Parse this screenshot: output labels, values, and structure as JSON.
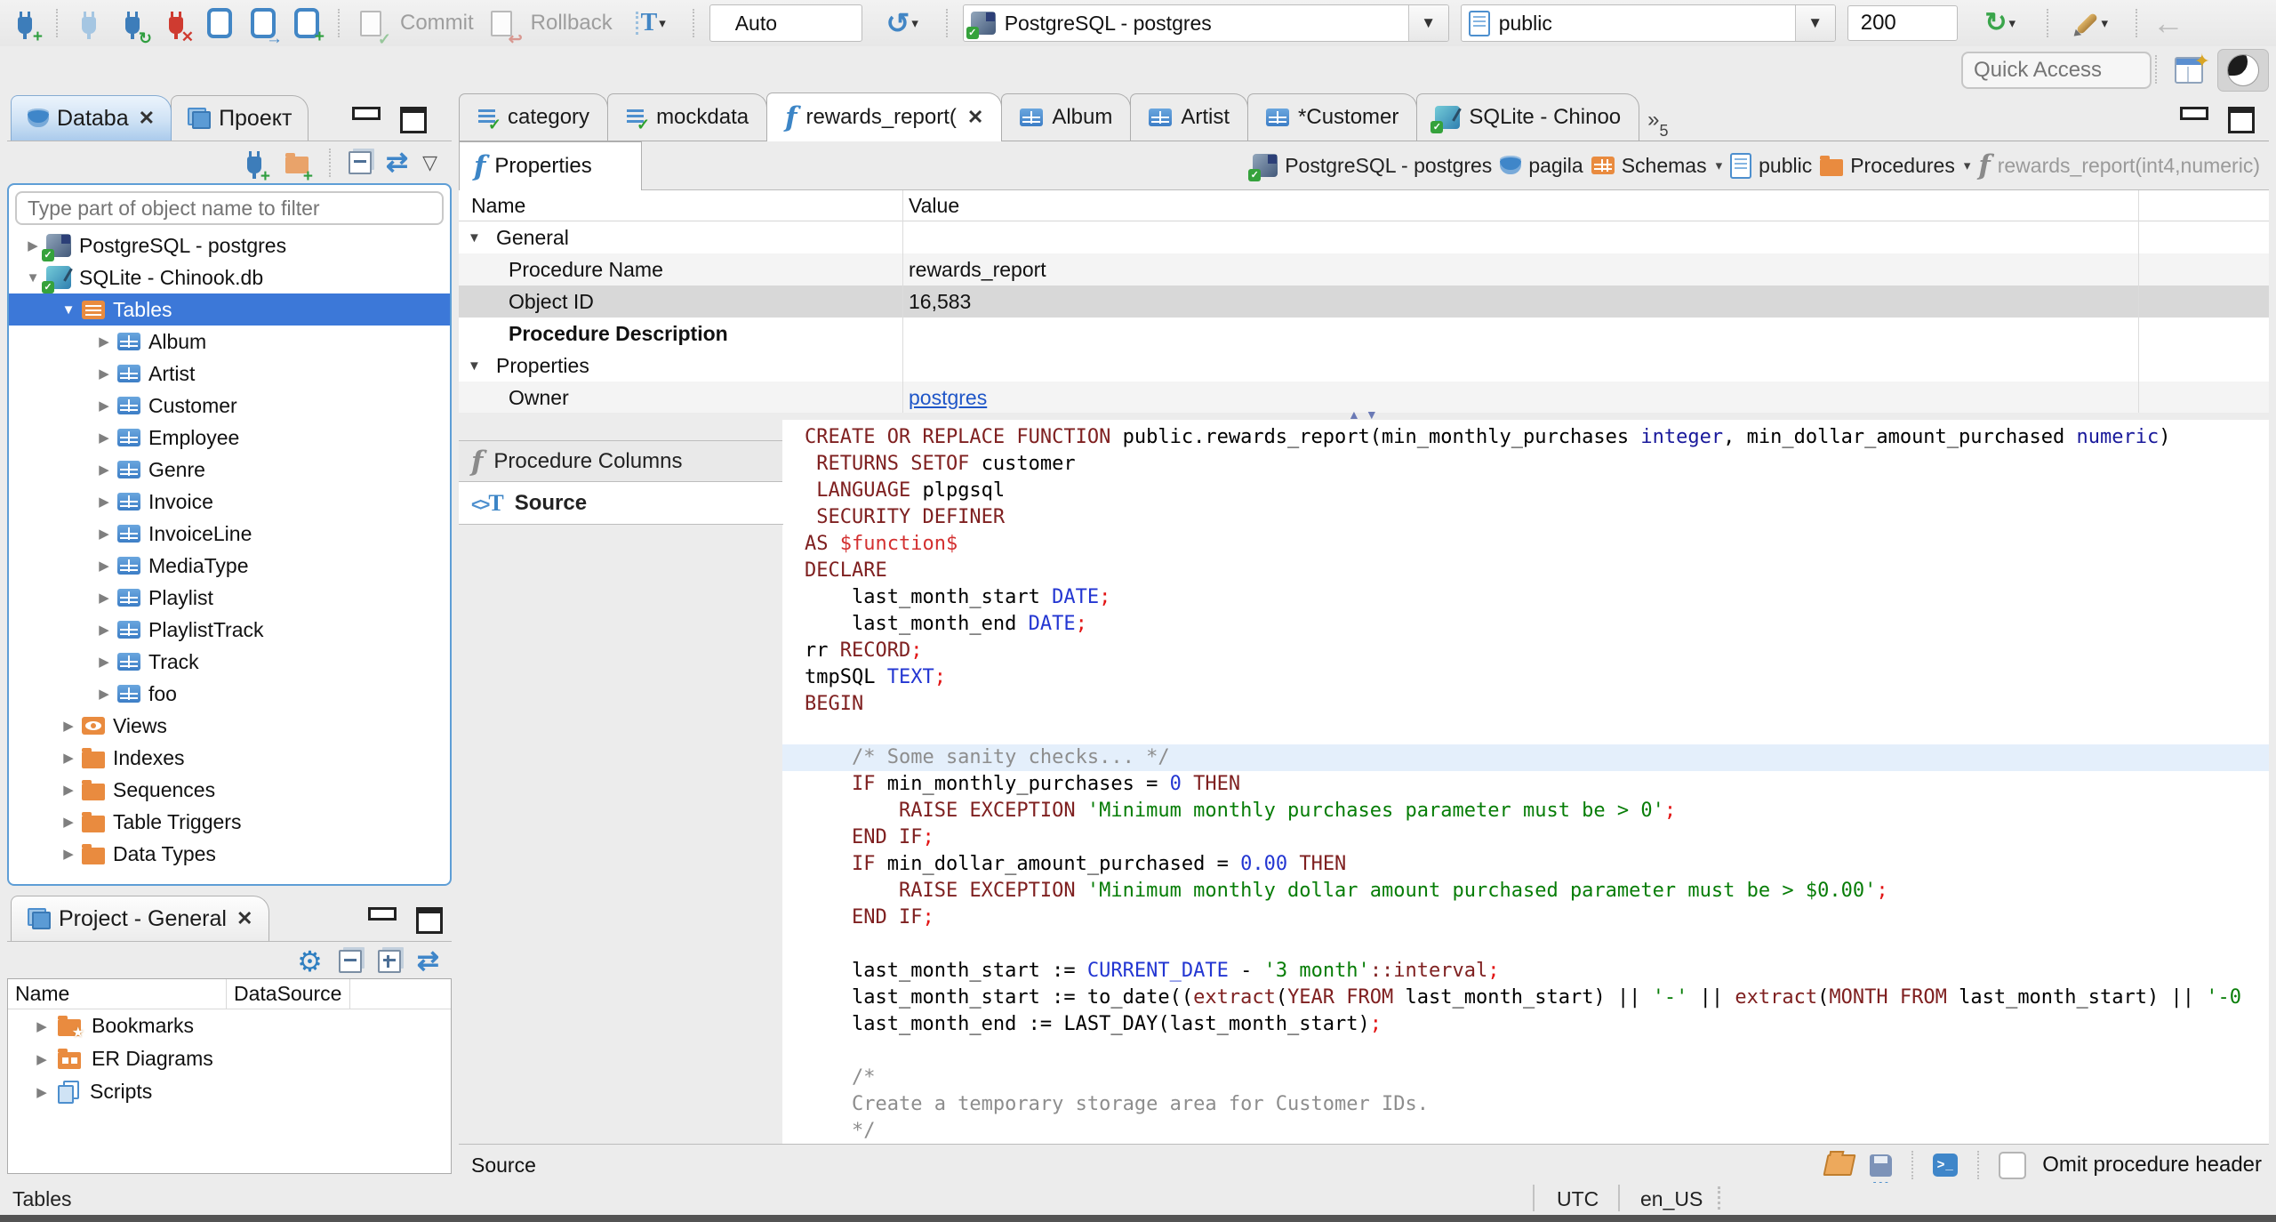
{
  "glyphs": {
    "expand": "▶",
    "collapse": "▼",
    "close": "✕",
    "caret": "▾",
    "vmenu": "▽",
    "gear": "⚙",
    "history": "↺",
    "refresh": "↻",
    "back": "←",
    "link": "⇄",
    "overflow": "»",
    "up": "▲",
    "down": "▼",
    "check": "✓",
    "star": "★",
    "terminal": ">_",
    "plus": "+",
    "undo": "↩",
    "arrow_r": "→",
    "tfilter": "T",
    "func_f": "f",
    "src_brackets": "<>",
    "src_t": "T"
  },
  "toolbar": {
    "commit_label": "Commit",
    "rollback_label": "Rollback",
    "auto_value": "Auto",
    "connection_value": "PostgreSQL - postgres",
    "schema_value": "public",
    "fetch_size_value": "200"
  },
  "quick_access_placeholder": "Quick Access",
  "left_panel": {
    "tabs": [
      {
        "label": "Databa"
      },
      {
        "label": "Проект"
      }
    ],
    "filter_placeholder": "Type part of object name to filter",
    "tree": [
      {
        "label": "PostgreSQL - postgres"
      },
      {
        "label": "SQLite - Chinook.db"
      },
      {
        "label": "Tables"
      },
      {
        "label": "Album"
      },
      {
        "label": "Artist"
      },
      {
        "label": "Customer"
      },
      {
        "label": "Employee"
      },
      {
        "label": "Genre"
      },
      {
        "label": "Invoice"
      },
      {
        "label": "InvoiceLine"
      },
      {
        "label": "MediaType"
      },
      {
        "label": "Playlist"
      },
      {
        "label": "PlaylistTrack"
      },
      {
        "label": "Track"
      },
      {
        "label": "foo"
      },
      {
        "label": "Views"
      },
      {
        "label": "Indexes"
      },
      {
        "label": "Sequences"
      },
      {
        "label": "Table Triggers"
      },
      {
        "label": "Data Types"
      }
    ]
  },
  "project_panel": {
    "title": "Project - General",
    "columns": {
      "name": "Name",
      "datasource": "DataSource"
    },
    "items": [
      {
        "label": "Bookmarks"
      },
      {
        "label": "ER Diagrams"
      },
      {
        "label": "Scripts"
      }
    ]
  },
  "editor": {
    "tabs": [
      {
        "label": "category"
      },
      {
        "label": "mockdata"
      },
      {
        "label": "rewards_report("
      },
      {
        "label": "Album"
      },
      {
        "label": "Artist"
      },
      {
        "label": "*Customer"
      },
      {
        "label": "SQLite - Chinoo"
      }
    ],
    "overflow_count": "5",
    "properties_tab_label": "Properties",
    "breadcrumb": [
      {
        "label": "PostgreSQL - postgres"
      },
      {
        "label": "pagila"
      },
      {
        "label": "Schemas"
      },
      {
        "label": "public"
      },
      {
        "label": "Procedures"
      },
      {
        "label": "rewards_report(int4,numeric)"
      }
    ],
    "grid": {
      "col_name": "Name",
      "col_value": "Value",
      "rows": [
        {
          "name": "General",
          "value": ""
        },
        {
          "name": "Procedure Name",
          "value": "rewards_report"
        },
        {
          "name": "Object ID",
          "value": "16,583"
        },
        {
          "name": "Procedure Description",
          "value": ""
        },
        {
          "name": "Properties",
          "value": ""
        },
        {
          "name": "Owner",
          "value": "postgres"
        }
      ]
    },
    "side_tabs": [
      {
        "label": "Procedure Columns"
      },
      {
        "label": "Source"
      }
    ],
    "code": [
      [
        {
          "c": "kw",
          "t": "CREATE OR REPLACE FUNCTION "
        },
        {
          "c": "df",
          "t": "public.rewards_report(min_monthly_purchases "
        },
        {
          "c": "ty",
          "t": "integer"
        },
        {
          "c": "df",
          "t": ", min_dollar_amount_purchased "
        },
        {
          "c": "ty",
          "t": "numeric"
        },
        {
          "c": "df",
          "t": ")"
        }
      ],
      [
        {
          "c": "kw",
          "t": " RETURNS SETOF "
        },
        {
          "c": "df",
          "t": "customer"
        }
      ],
      [
        {
          "c": "kw",
          "t": " LANGUAGE "
        },
        {
          "c": "df",
          "t": "plpgsql"
        }
      ],
      [
        {
          "c": "kw",
          "t": " SECURITY DEFINER"
        }
      ],
      [
        {
          "c": "kw",
          "t": "AS "
        },
        {
          "c": "dl",
          "t": "$function$"
        }
      ],
      [
        {
          "c": "kw",
          "t": "DECLARE"
        }
      ],
      [
        {
          "c": "df",
          "t": "    last_month_start "
        },
        {
          "c": "bi",
          "t": "DATE"
        },
        {
          "c": "pu",
          "t": ";"
        }
      ],
      [
        {
          "c": "df",
          "t": "    last_month_end "
        },
        {
          "c": "bi",
          "t": "DATE"
        },
        {
          "c": "pu",
          "t": ";"
        }
      ],
      [
        {
          "c": "df",
          "t": "rr "
        },
        {
          "c": "kw",
          "t": "RECORD"
        },
        {
          "c": "pu",
          "t": ";"
        }
      ],
      [
        {
          "c": "df",
          "t": "tmpSQL "
        },
        {
          "c": "bi",
          "t": "TEXT"
        },
        {
          "c": "pu",
          "t": ";"
        }
      ],
      [
        {
          "c": "kw",
          "t": "BEGIN"
        }
      ],
      [],
      [
        {
          "c": "cm",
          "t": "    /* Some sanity checks... */"
        }
      ],
      [
        {
          "c": "df",
          "t": "    "
        },
        {
          "c": "kw",
          "t": "IF"
        },
        {
          "c": "df",
          "t": " min_monthly_purchases = "
        },
        {
          "c": "nu",
          "t": "0"
        },
        {
          "c": "kw",
          "t": " THEN"
        }
      ],
      [
        {
          "c": "df",
          "t": "        "
        },
        {
          "c": "kw",
          "t": "RAISE EXCEPTION "
        },
        {
          "c": "st",
          "t": "'Minimum monthly purchases parameter must be > 0'"
        },
        {
          "c": "pu",
          "t": ";"
        }
      ],
      [
        {
          "c": "df",
          "t": "    "
        },
        {
          "c": "kw",
          "t": "END IF"
        },
        {
          "c": "pu",
          "t": ";"
        }
      ],
      [
        {
          "c": "df",
          "t": "    "
        },
        {
          "c": "kw",
          "t": "IF"
        },
        {
          "c": "df",
          "t": " min_dollar_amount_purchased = "
        },
        {
          "c": "nu",
          "t": "0.00"
        },
        {
          "c": "kw",
          "t": " THEN"
        }
      ],
      [
        {
          "c": "df",
          "t": "        "
        },
        {
          "c": "kw",
          "t": "RAISE EXCEPTION "
        },
        {
          "c": "st",
          "t": "'Minimum monthly dollar amount purchased parameter must be > $0.00'"
        },
        {
          "c": "pu",
          "t": ";"
        }
      ],
      [
        {
          "c": "df",
          "t": "    "
        },
        {
          "c": "kw",
          "t": "END IF"
        },
        {
          "c": "pu",
          "t": ";"
        }
      ],
      [],
      [
        {
          "c": "df",
          "t": "    last_month_start := "
        },
        {
          "c": "bi",
          "t": "CURRENT_DATE"
        },
        {
          "c": "df",
          "t": " - "
        },
        {
          "c": "st",
          "t": "'3 month'"
        },
        {
          "c": "kw",
          "t": "::interval"
        },
        {
          "c": "pu",
          "t": ";"
        }
      ],
      [
        {
          "c": "df",
          "t": "    last_month_start := to_date(("
        },
        {
          "c": "kw",
          "t": "extract"
        },
        {
          "c": "df",
          "t": "("
        },
        {
          "c": "kw",
          "t": "YEAR FROM"
        },
        {
          "c": "df",
          "t": " last_month_start) || "
        },
        {
          "c": "st",
          "t": "'-'"
        },
        {
          "c": "df",
          "t": " || "
        },
        {
          "c": "kw",
          "t": "extract"
        },
        {
          "c": "df",
          "t": "("
        },
        {
          "c": "kw",
          "t": "MONTH FROM"
        },
        {
          "c": "df",
          "t": " last_month_start) || "
        },
        {
          "c": "st",
          "t": "'-0"
        }
      ],
      [
        {
          "c": "df",
          "t": "    last_month_end := LAST_DAY(last_month_start)"
        },
        {
          "c": "pu",
          "t": ";"
        }
      ],
      [],
      [
        {
          "c": "cm",
          "t": "    /*"
        }
      ],
      [
        {
          "c": "cm",
          "t": "    Create a temporary storage area for Customer IDs."
        }
      ],
      [
        {
          "c": "cm",
          "t": "    */"
        }
      ]
    ],
    "bottom_bar": {
      "label": "Source",
      "checkbox_label": "Omit procedure header"
    }
  },
  "status_bar": {
    "left": "Tables",
    "timezone": "UTC",
    "locale": "en_US"
  }
}
